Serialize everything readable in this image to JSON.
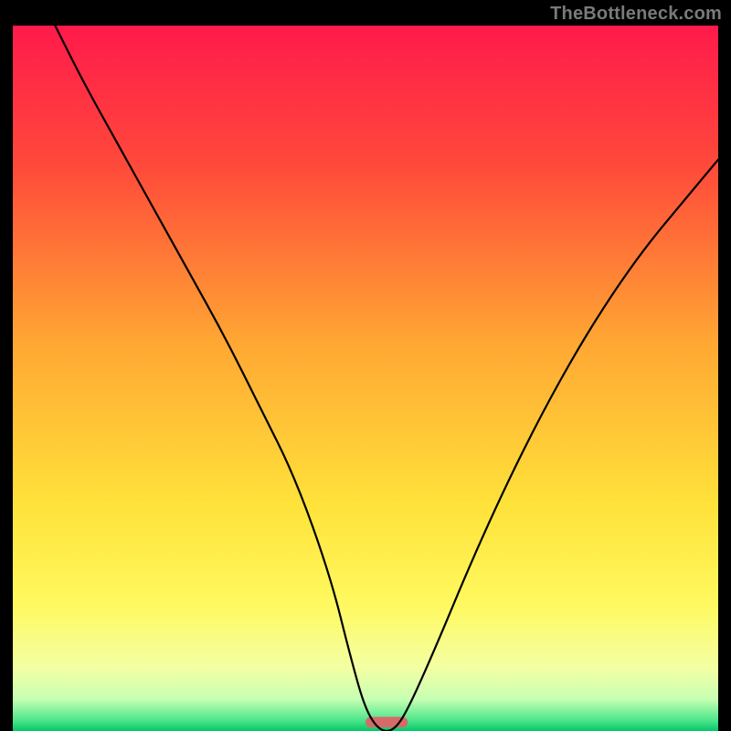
{
  "attribution": "TheBottleneck.com",
  "chart_data": {
    "type": "line",
    "title": "",
    "xlabel": "",
    "ylabel": "",
    "xlim": [
      0,
      100
    ],
    "ylim": [
      0,
      100
    ],
    "gradient_stops": [
      {
        "offset": 0.0,
        "color": "#ff1a4b"
      },
      {
        "offset": 0.2,
        "color": "#ff4a3a"
      },
      {
        "offset": 0.45,
        "color": "#ffa733"
      },
      {
        "offset": 0.68,
        "color": "#ffe23a"
      },
      {
        "offset": 0.82,
        "color": "#fff95f"
      },
      {
        "offset": 0.91,
        "color": "#f4ffa3"
      },
      {
        "offset": 0.955,
        "color": "#c7ffb3"
      },
      {
        "offset": 0.985,
        "color": "#4ce68a"
      },
      {
        "offset": 1.0,
        "color": "#06c66a"
      }
    ],
    "series": [
      {
        "name": "bottleneck-curve",
        "x": [
          6,
          10,
          15,
          20,
          25,
          30,
          35,
          40,
          45,
          48,
          50,
          52,
          54,
          56,
          60,
          65,
          70,
          75,
          80,
          85,
          90,
          95,
          100
        ],
        "y": [
          100,
          92,
          83,
          74,
          65,
          56,
          46,
          36,
          22,
          10,
          3,
          0,
          0,
          3,
          12,
          24,
          35,
          45,
          54,
          62,
          69,
          75,
          81
        ]
      }
    ],
    "marker": {
      "x_center": 53,
      "y": 0.5,
      "width": 6,
      "height": 1.5
    }
  }
}
